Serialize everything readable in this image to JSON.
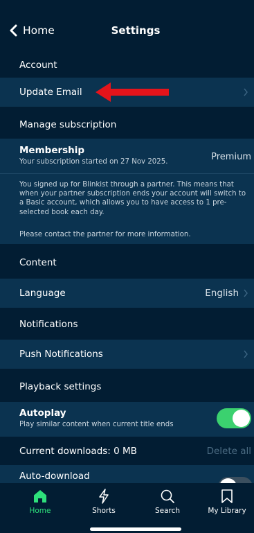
{
  "header": {
    "back_label": "Home",
    "title": "Settings"
  },
  "account": {
    "section_label": "Account",
    "update_email_label": "Update Email"
  },
  "subscription": {
    "section_label": "Manage subscription",
    "membership_title": "Membership",
    "membership_started": "Your subscription started on 27 Nov 2025.",
    "membership_tier": "Premium",
    "partner_note_1": "You signed up for Blinkist through a partner. This means that when your partner subscription ends your account will switch to a Basic account, which allows you to have access to 1 pre-selected book each day.",
    "partner_note_2": "Please contact the partner for more information."
  },
  "content": {
    "section_label": "Content",
    "language_label": "Language",
    "language_value": "English"
  },
  "notifications": {
    "section_label": "Notifications",
    "push_label": "Push Notifications"
  },
  "playback": {
    "section_label": "Playback settings",
    "autoplay_title": "Autoplay",
    "autoplay_sub": "Play similar content when current title ends",
    "autoplay_on": true,
    "downloads_label": "Current downloads: 0 MB",
    "delete_all_label": "Delete all",
    "auto_download_label": "Auto-download"
  },
  "tabs": [
    {
      "label": "Home",
      "icon": "home-icon",
      "active": true
    },
    {
      "label": "Shorts",
      "icon": "lightning-icon",
      "active": false
    },
    {
      "label": "Search",
      "icon": "search-icon",
      "active": false
    },
    {
      "label": "My Library",
      "icon": "bookmark-icon",
      "active": false
    }
  ],
  "colors": {
    "background": "#021d33",
    "row": "#0b3350",
    "accent_green": "#2ee07b",
    "toggle_green": "#3bd16f",
    "annotation_red": "#e4141b"
  }
}
